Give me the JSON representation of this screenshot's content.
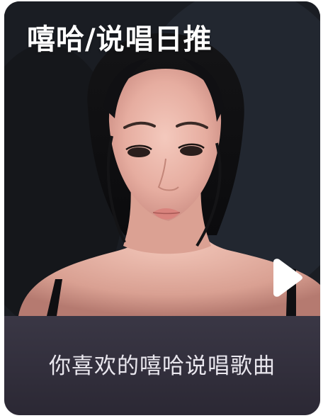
{
  "playlist": {
    "title": "嘻哈/说唱日推",
    "description": "你喜欢的嘻哈说唱歌曲",
    "cover_icon": "play-icon",
    "colors": {
      "caption_bar": "#312e3b",
      "title_text": "#ffffff",
      "caption_text": "#e9e7ee",
      "cover_background": "#1c2027"
    }
  }
}
